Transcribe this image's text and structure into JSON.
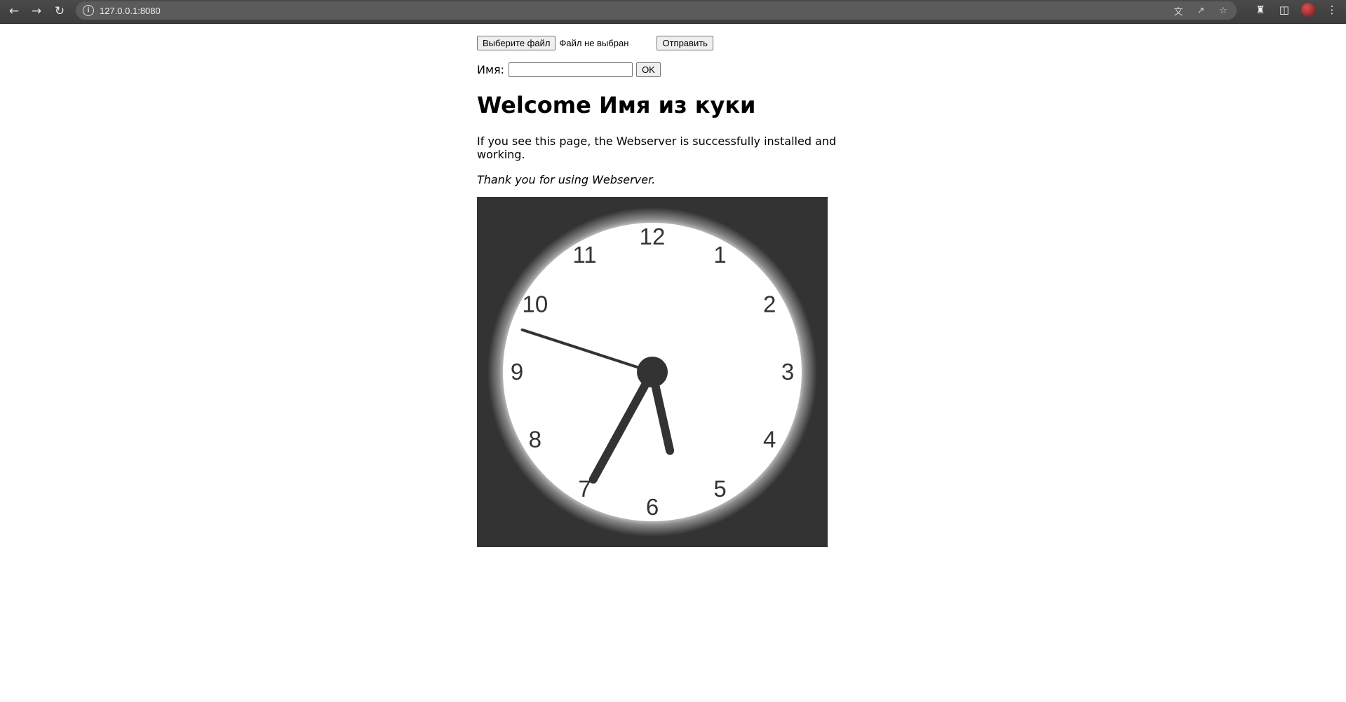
{
  "browser": {
    "url": "127.0.0.1:8080",
    "icons": {
      "back": "back-arrow-icon",
      "forward": "forward-arrow-icon",
      "reload": "reload-icon",
      "site_info": "info-icon",
      "translate": "translate-icon",
      "share": "share-icon",
      "bookmark": "star-icon",
      "extensions": "puzzle-icon",
      "side_panel": "side-panel-icon",
      "profile": "avatar",
      "menu": "kebab-menu-icon"
    }
  },
  "upload": {
    "choose_label": "Выберите файл",
    "status_text": "Файл не выбран",
    "submit_label": "Отправить"
  },
  "name_form": {
    "label": "Имя:",
    "value": "",
    "ok_label": "OK"
  },
  "main": {
    "heading": "Welcome Имя из куки",
    "paragraph": "If you see this page, the Webserver is successfully installed and working.",
    "thanks": "Thank you for using Webserver."
  },
  "clock": {
    "numbers": [
      "12",
      "1",
      "2",
      "3",
      "4",
      "5",
      "6",
      "7",
      "8",
      "9",
      "10",
      "11"
    ],
    "time": {
      "hours": 5,
      "minutes": 34,
      "seconds": 48
    },
    "colors": {
      "background": "#333333",
      "face": "#ffffff",
      "hands": "#333333",
      "numerals": "#333333"
    }
  }
}
